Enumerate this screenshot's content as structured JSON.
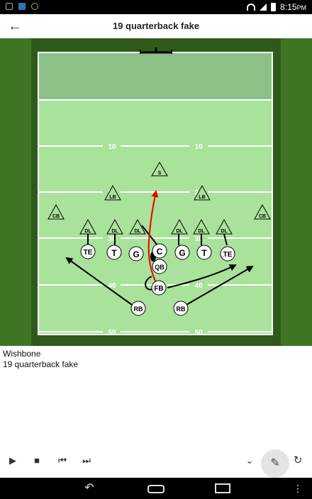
{
  "status": {
    "time": "8:15",
    "meridiem": "PM"
  },
  "toolbar": {
    "title": "19 quarterback fake"
  },
  "field": {
    "yard_labels": [
      "10",
      "10",
      "20",
      "20",
      "30",
      "30",
      "40",
      "40",
      "50",
      "50"
    ],
    "defense": [
      {
        "id": "S",
        "label": "S"
      },
      {
        "id": "LB-left",
        "label": "LB"
      },
      {
        "id": "LB-right",
        "label": "LB"
      },
      {
        "id": "CB-left",
        "label": "CB"
      },
      {
        "id": "CB-right",
        "label": "CB"
      },
      {
        "id": "DL-1",
        "label": "DL"
      },
      {
        "id": "DL-2",
        "label": "DL"
      },
      {
        "id": "DL-3",
        "label": "DL"
      },
      {
        "id": "DL-4",
        "label": "DL"
      },
      {
        "id": "DL-5",
        "label": "DL"
      },
      {
        "id": "DL-6",
        "label": "DL"
      }
    ],
    "offense": [
      {
        "id": "TE-left",
        "label": "TE"
      },
      {
        "id": "T-left",
        "label": "T"
      },
      {
        "id": "G-left",
        "label": "G"
      },
      {
        "id": "C",
        "label": "C"
      },
      {
        "id": "G-right",
        "label": "G"
      },
      {
        "id": "T-right",
        "label": "T"
      },
      {
        "id": "TE-right",
        "label": "TE"
      },
      {
        "id": "QB",
        "label": "QB"
      },
      {
        "id": "FB",
        "label": "FB"
      },
      {
        "id": "RB-left",
        "label": "RB"
      },
      {
        "id": "RB-right",
        "label": "RB"
      }
    ]
  },
  "info": {
    "formation": "Wishbone",
    "play": "19 quarterback fake"
  },
  "icons": {
    "back": "arrow-left-icon",
    "play": "play-icon",
    "stop": "stop-icon",
    "prev": "skip-previous-icon",
    "next": "skip-next-icon",
    "expand": "chevron-down-icon",
    "edit": "pencil-icon",
    "refresh": "refresh-icon"
  }
}
